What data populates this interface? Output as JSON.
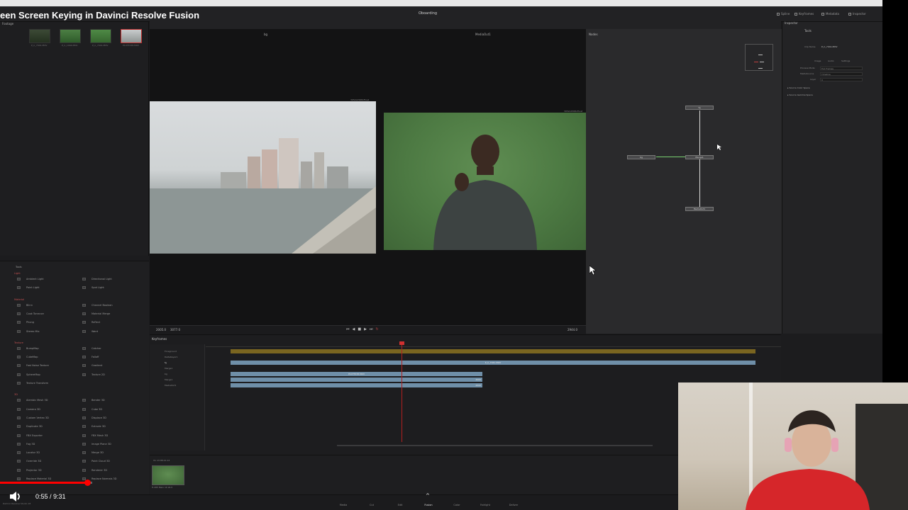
{
  "video": {
    "title": "een Screen Keying in Davinci Resolve Fusion",
    "time_current": "0:55",
    "time_total": "9:31",
    "progress": 0.096,
    "accent": "#ff0000"
  },
  "app": {
    "title": "Oboarding",
    "top_right": [
      "Spline",
      "Keyframes",
      "Metadata",
      "Inspector"
    ],
    "pool_label": "Footage"
  },
  "media_pool": {
    "thumbs": [
      {
        "label": "P_C_7041.MOV"
      },
      {
        "label": "P_C_1044.MOV"
      },
      {
        "label": "P_C_7041.MOV"
      },
      {
        "label": "P1075538.MOV"
      }
    ]
  },
  "viewer": {
    "left_label": "bg",
    "right_label": "MediaOut1",
    "left_res": "3952x2568xFloat",
    "right_res": "3952x2568xFloat"
  },
  "nodes": {
    "title": "Nodes",
    "items": [
      "fg",
      "bg",
      "Merge1",
      "MediaOut1"
    ]
  },
  "inspector": {
    "title": "Inspector",
    "tab_tools": "Tools",
    "clip_name_label": "Clip Name",
    "clip_name_value": "P_C_7041.MOV",
    "sub_tabs": [
      "Image",
      "Audio",
      "Settings"
    ],
    "rows": [
      {
        "label": "Process Mode",
        "value": "Full Frames"
      },
      {
        "label": "MediaSource",
        "value": "Timeline"
      },
      {
        "label": "Layer",
        "value": "0"
      }
    ],
    "sections": [
      "Source Color Space",
      "Source Gamma Space"
    ]
  },
  "effects": {
    "title": "Tools",
    "categories": [
      {
        "name": "Light",
        "items": [
          [
            "Ambient Light",
            "Directional Light"
          ],
          [
            "Point Light",
            "Spot Light"
          ]
        ]
      },
      {
        "name": "Material",
        "items": [
          [
            "Blinn",
            "Channel Boolean"
          ],
          [
            "Cook Torrance",
            "Material Merge"
          ],
          [
            "Phong",
            "Reflect"
          ],
          [
            "Stereo Mix",
            "Ward"
          ]
        ]
      },
      {
        "name": "Texture",
        "items": [
          [
            "BumpMap",
            "Catcher"
          ],
          [
            "CubeMap",
            "Falloff"
          ],
          [
            "Fast Noise Texture",
            "Gradient"
          ],
          [
            "SphereMap",
            "Texture 2D"
          ],
          [
            "Texture Transform",
            ""
          ]
        ]
      },
      {
        "name": "3D",
        "items": [
          [
            "Alembic Mesh 3D",
            "Bender 3D"
          ],
          [
            "Camera 3D",
            "Cube 3D"
          ],
          [
            "Custom Vertex 3D",
            "Displace 3D"
          ],
          [
            "Duplicate 3D",
            "Extrude 3D"
          ],
          [
            "FBX Exporter",
            "FBX Mesh 3D"
          ],
          [
            "Fog 3D",
            "Image Plane 3D"
          ],
          [
            "Locator 3D",
            "Merge 3D"
          ],
          [
            "Override 3D",
            "Point Cloud 3D"
          ],
          [
            "Projector 3D",
            "Renderer 3D"
          ],
          [
            "Replace Material 3D",
            "Replace Normals 3D"
          ]
        ]
      }
    ]
  },
  "transport": {
    "start": "2005.0",
    "end": "3077.0",
    "current": "2944.0"
  },
  "keyframes": {
    "title": "Keyframes",
    "tree": [
      "Foreground",
      "DeltaKeyer1",
      "fg",
      "Merge1",
      "bg",
      "Merge1",
      "MediaOut1"
    ],
    "clip_fg": "P_C_7041.MOV",
    "clip_bg": "P1075538.MOV",
    "val_a": "4000",
    "val_b": "4343"
  },
  "clip_strip": {
    "tc": "13:38:11:12",
    "codec": "H.265 Main 10 L6.0",
    "track": "V1"
  },
  "pages": [
    "Media",
    "Cut",
    "Edit",
    "Fusion",
    "Color",
    "Fairlight",
    "Deliver"
  ],
  "active_page": "Fusion",
  "version_label": "DaVinci Resolve Studio 18"
}
